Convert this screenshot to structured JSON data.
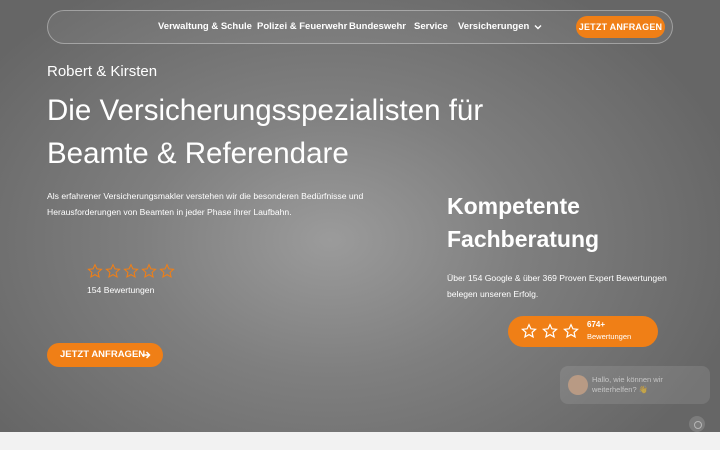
{
  "nav": {
    "items": [
      "Verwaltung & Schule",
      "Polizei & Feuerwehr",
      "Bundeswehr",
      "Service",
      "Versicherungen"
    ],
    "cta_label": "JETZT ANFRAGEN",
    "dropdown_icon": "chevron-down-icon"
  },
  "hero": {
    "eyebrow": "Robert & Kirsten",
    "title_line1": "Die Versicherungsspezialisten für",
    "title_line2": "Beamte & Referendare",
    "intro_line1": "Als erfahrener Versicherungsmakler verstehen wir die besonderen Bedürfnisse und",
    "intro_line2": "Herausforderungen von Beamten in jeder Phase ihrer Laufbahn.",
    "rating_count": "154 Bewertungen",
    "rating_stars": 0,
    "cta_label": "JETZT ANFRAGEN"
  },
  "side": {
    "title_line1": "Kompetente",
    "title_line2": "Fachberatung",
    "text_line1": "Über 154 Google & über 369 Proven Expert Bewertungen",
    "text_line2": "belegen unseren Erfolg.",
    "badge_count": "674+",
    "badge_label": "Bewertungen"
  },
  "chat": {
    "message": "Hallo, wie können wir weiterhelfen? 👋"
  },
  "colors": {
    "accent": "#f07f16",
    "text": "#ffffff"
  }
}
